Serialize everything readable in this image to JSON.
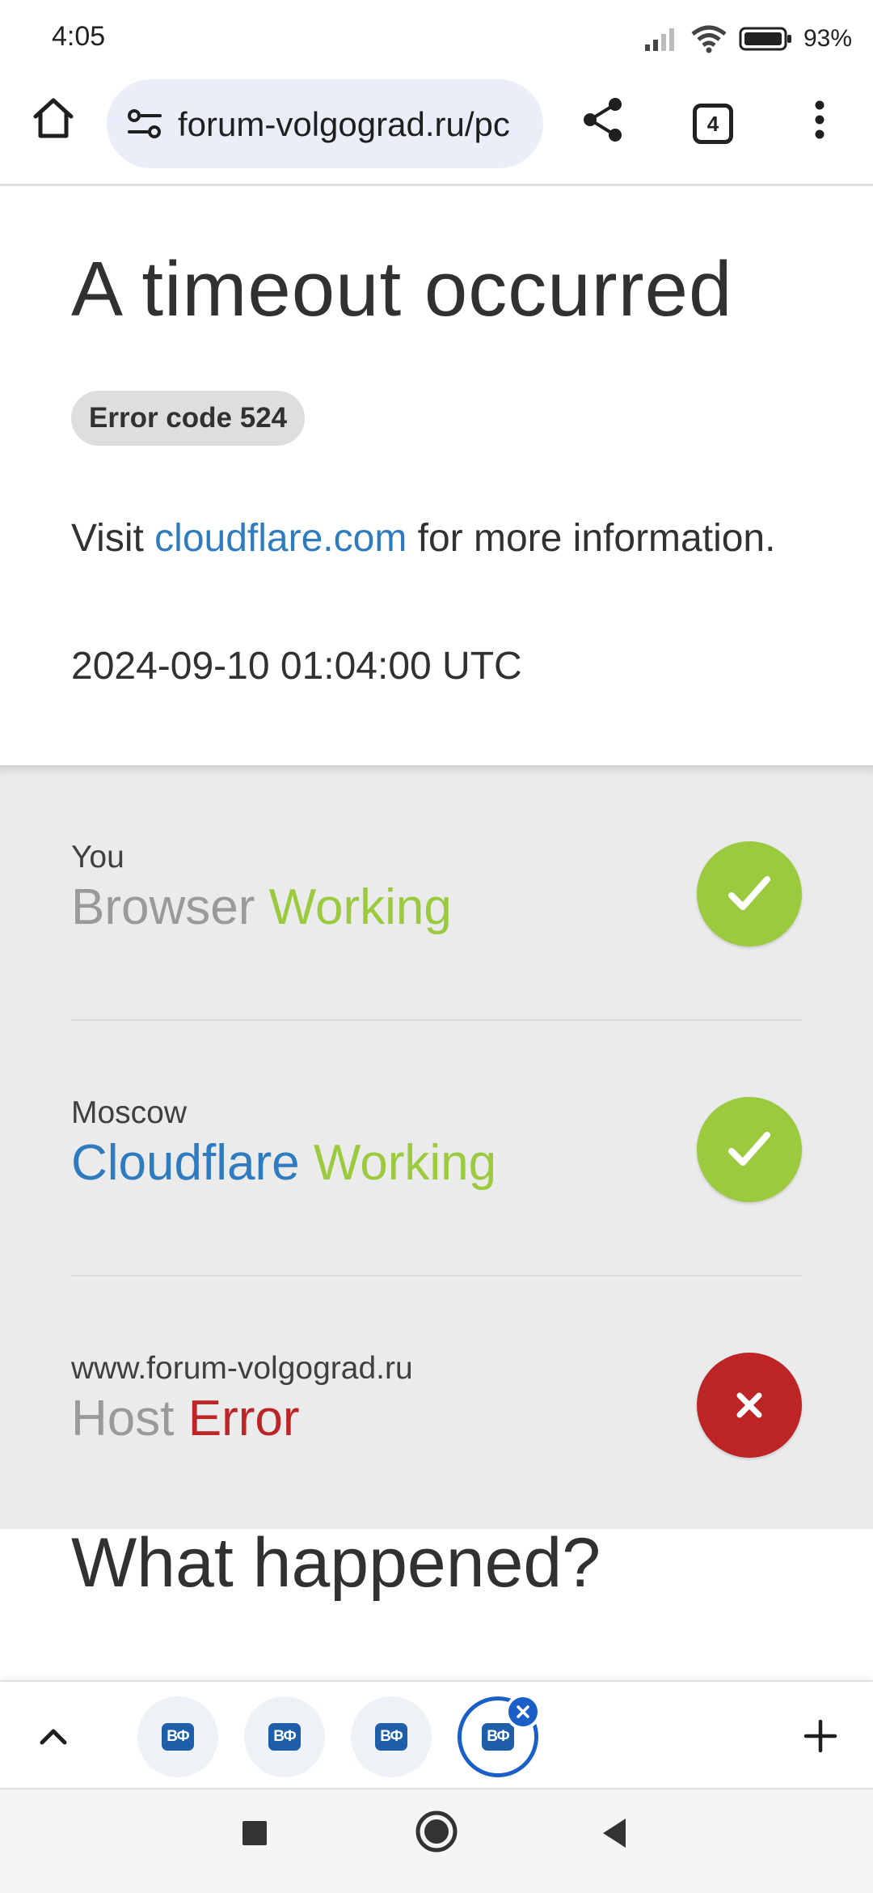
{
  "status_bar": {
    "time": "4:05",
    "battery_percent": "93%"
  },
  "toolbar": {
    "url": "forum-volgograd.ru/pc",
    "tab_count": "4"
  },
  "page": {
    "title": "A timeout occurred",
    "error_code": "Error code 524",
    "visit_prefix": "Visit ",
    "visit_link": "cloudflare.com",
    "visit_suffix": " for more information.",
    "timestamp": "2024-09-10 01:04:00 UTC",
    "what_happened": "What happened?"
  },
  "nodes": [
    {
      "location": "You",
      "name": "Browser",
      "status": "Working",
      "state": "ok"
    },
    {
      "location": "Moscow",
      "name": "Cloudflare",
      "status": "Working",
      "state": "ok"
    },
    {
      "location": "www.forum-volgograd.ru",
      "name": "Host",
      "status": "Error",
      "state": "error"
    }
  ],
  "tabstrip": {
    "favicon_label": "ВФ",
    "tab_total": 4,
    "active_tab": 4
  },
  "colors": {
    "ok": "#9bca3e",
    "error": "#bd2426",
    "link": "#2f7bbf",
    "active_tab": "#1a5fc8"
  }
}
